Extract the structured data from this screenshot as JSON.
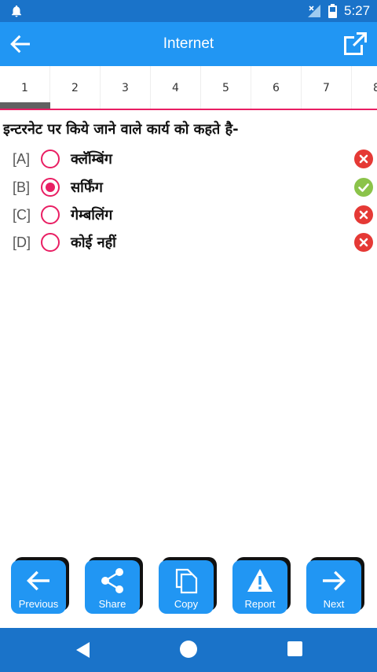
{
  "status_bar": {
    "time": "5:27"
  },
  "app_bar": {
    "title": "Internet"
  },
  "tabs": [
    "1",
    "2",
    "3",
    "4",
    "5",
    "6",
    "7",
    "8"
  ],
  "question": "इन्टरनेट पर किये जाने वाले कार्य को कहते है-",
  "options": [
    {
      "letter": "[A]",
      "text": "क्लॅम्बिंग",
      "selected": false,
      "status": "wrong"
    },
    {
      "letter": "[B]",
      "text": "सर्फिंग",
      "selected": true,
      "status": "correct"
    },
    {
      "letter": "[C]",
      "text": "गेम्बलिंग",
      "selected": false,
      "status": "wrong"
    },
    {
      "letter": "[D]",
      "text": "कोई नहीं",
      "selected": false,
      "status": "wrong"
    }
  ],
  "buttons": {
    "previous": "Previous",
    "share": "Share",
    "copy": "Copy",
    "report": "Report",
    "next": "Next"
  },
  "colors": {
    "status_bar": "#1a73c9",
    "app_bar": "#2196f3",
    "accent": "#e91e63",
    "correct": "#8bc34a",
    "wrong": "#e53935"
  }
}
